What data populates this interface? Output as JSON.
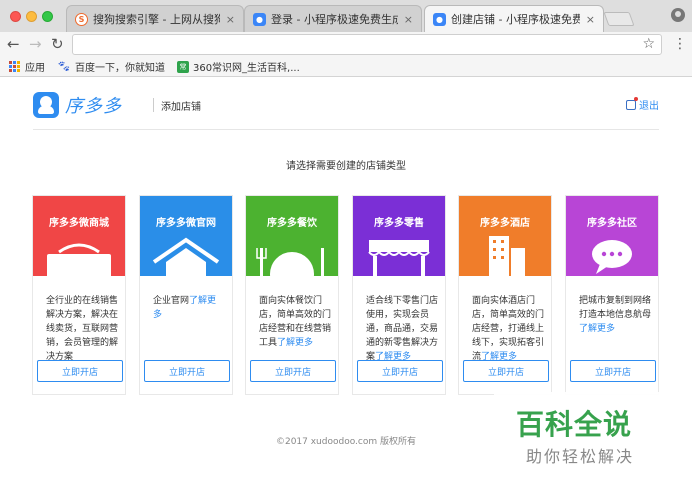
{
  "browser": {
    "tabs": [
      {
        "title": "搜狗搜索引擎 - 上网从搜狗开始",
        "favicon": "sogou-icon",
        "active": false
      },
      {
        "title": "登录 - 小程序极速免费生成",
        "favicon": "xiaoduoduo-icon",
        "active": false
      },
      {
        "title": "创建店铺 - 小程序极速免费生成",
        "favicon": "xiaoduoduo-icon",
        "active": true
      }
    ],
    "close_glyph": "×",
    "address": "",
    "bookmarks": [
      {
        "label": "应用",
        "icon": "apps-icon"
      },
      {
        "label": "百度一下，你就知道",
        "icon": "baidu-paw-icon"
      },
      {
        "label": "360常识网_生活百科,...",
        "icon": "360-icon"
      }
    ]
  },
  "header": {
    "logo_text": "序多多",
    "section": "添加店铺",
    "logout": "退出"
  },
  "prompt": "请选择需要创建的店铺类型",
  "cards": [
    {
      "title": "序多多微商城",
      "color": "#f04646",
      "graphic": "shopping-bag-icon",
      "desc": "全行业的在线销售解决方案，解决在线卖货，互联网营销，会员管理的解决方案",
      "more": "",
      "button": "立即开店"
    },
    {
      "title": "序多多微官网",
      "color": "#2a8ee8",
      "graphic": "house-icon",
      "desc": "企业官网",
      "more": "了解更多",
      "button": "立即开店"
    },
    {
      "title": "序多多餐饮",
      "color": "#4cb230",
      "graphic": "plate-cutlery-icon",
      "desc": "面向实体餐饮门店，简单高效的门店经营和在线营销工具",
      "more": "了解更多",
      "button": "立即开店"
    },
    {
      "title": "序多多零售",
      "color": "#7b2fd6",
      "graphic": "storefront-icon",
      "desc": "适合线下零售门店使用，实现会员通，商品通，交易通的新零售解决方案",
      "more": "了解更多",
      "button": "立即开店"
    },
    {
      "title": "序多多酒店",
      "color": "#f07d2a",
      "graphic": "hotel-building-icon",
      "desc": "面向实体酒店门店，简单高效的门店经营，打通线上线下，实现拓客引流",
      "more": "了解更多",
      "button": "立即开店"
    },
    {
      "title": "序多多社区",
      "color": "#b845d6",
      "graphic": "chat-bubble-icon",
      "desc": "把城市复制到网络 打造本地信息航母",
      "more": "了解更多",
      "button": "立即开店"
    }
  ],
  "footer": "©2017 xudoodoo.com 版权所有",
  "watermark": {
    "title": "百科全说",
    "subtitle": "助你轻松解决"
  }
}
